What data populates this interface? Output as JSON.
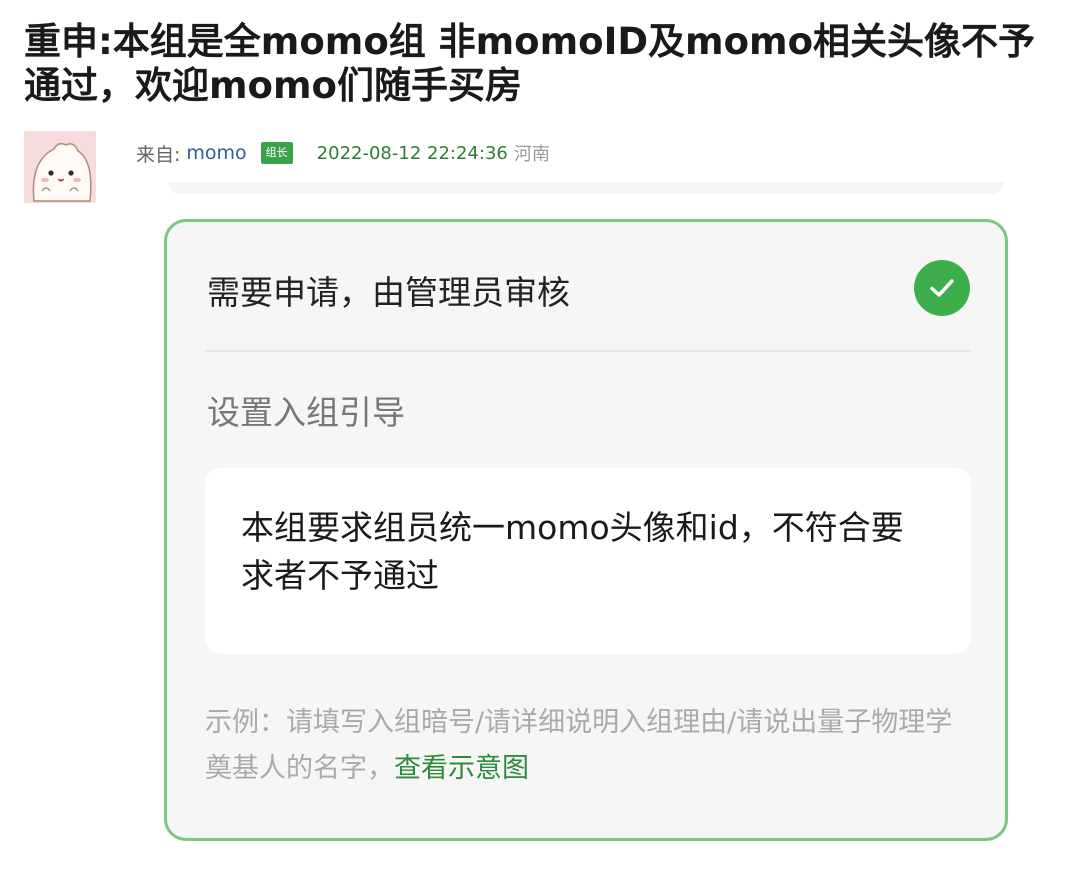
{
  "post": {
    "title": "重申:本组是全momo组 非momoID及momo相关头像不予通过，欢迎momo们随手买房"
  },
  "meta": {
    "from_label": "来自:",
    "author": "momo",
    "role_badge": "组长",
    "datetime": "2022-08-12 22:24:36",
    "location": "河南"
  },
  "card": {
    "option_label": "需要申请，由管理员审核",
    "option_checked": true,
    "section_label": "设置入组引导",
    "guide_text": "本组要求组员统一momo头像和id，不符合要求者不予通过",
    "example_text": "示例：请填写入组暗号/请详细说明入组理由/请说出量子物理学奠基人的名字，",
    "example_link": "查看示意图"
  },
  "colors": {
    "accent_green": "#3cae4b",
    "card_border": "#7bc77e",
    "author_blue": "#2f5e9c",
    "time_green": "#2e7d32"
  },
  "icons": {
    "check": "check-circle-icon",
    "avatar": "cute-ghost-avatar"
  }
}
